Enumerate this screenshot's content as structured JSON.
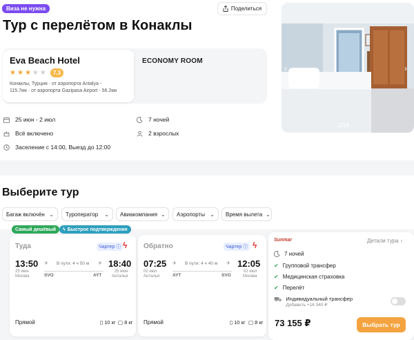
{
  "header": {
    "visa_badge": "Виза не нужна",
    "share_label": "Поделиться",
    "title": "Тур с перелётом в Конаклы"
  },
  "hotel": {
    "name": "Eva Beach Hotel",
    "stars": 3,
    "stars_max": 5,
    "rating": "7.3",
    "location_line1": "Конаклы, Турция · от аэропорта Antalya -",
    "location_line2": "115.7км · от аэропорта Gazipasa Airport - 56.2км",
    "room": "ECONOMY ROOM"
  },
  "photo": {
    "counter": "2/14",
    "prev_icon": "chevron-left-icon",
    "next_icon": "chevron-right-icon"
  },
  "trip_info": {
    "dates": "25 июн - 2 июл",
    "nights": "7 ночей",
    "meal": "Всё включено",
    "guests": "2 взрослых",
    "checkin": "Заселение с 14:00, Выезд до 12:00"
  },
  "tours_section": {
    "title": "Выберите тур",
    "filters": [
      "Багаж включён",
      "Туроператор",
      "Авиакомпания",
      "Аэропорты",
      "Время вылета"
    ]
  },
  "tags": {
    "cheapest": "Самый дешёвый",
    "fast": "Быстрое подтверждение"
  },
  "flights": {
    "outbound": {
      "direction": "Туда",
      "charter": "Чартер",
      "dep_time": "13:50",
      "arr_time": "18:40",
      "duration": "В пути: 4 ч 50 м",
      "dep_date": "25 июн",
      "dep_city": "Москва",
      "dep_code": "SVO",
      "arr_date": "25 июн",
      "arr_city": "Анталья",
      "arr_code": "AYT",
      "type": "Прямой",
      "bag1": "10 кг",
      "bag2": "8 кг"
    },
    "inbound": {
      "direction": "Обратно",
      "charter": "Чартер",
      "dep_time": "07:25",
      "arr_time": "12:05",
      "duration": "В пути: 4 ч 40 м",
      "dep_date": "02 июл",
      "dep_city": "Анталья",
      "dep_code": "AYT",
      "arr_date": "02 июл",
      "arr_city": "Москва",
      "arr_code": "SVO",
      "type": "Прямой",
      "bag1": "10 кг",
      "bag2": "8 кг"
    }
  },
  "tour_details": {
    "operator_logo": "Sunmar",
    "details_link": "Детали тура",
    "nights": "7 ночей",
    "includes": [
      "Групповой трансфер",
      "Медицинская страховка",
      "Перелёт"
    ],
    "individual_transfer": "Индивидуальный трансфер",
    "individual_transfer_price": "Добавить +16 340 ₽",
    "price": "73 155 ₽",
    "choose_button": "Выбрать тур"
  },
  "colors": {
    "accent_orange": "#f4a340",
    "visa_purple": "#7b4cf0",
    "cheap_green": "#2fa85a",
    "fast_teal": "#2e9fbd",
    "check_green": "#2fa85a"
  }
}
